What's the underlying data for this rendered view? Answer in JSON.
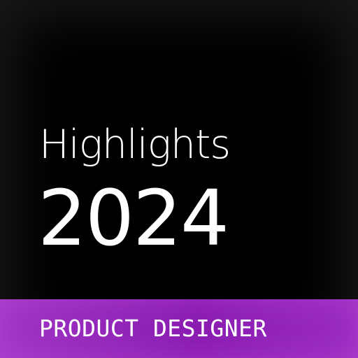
{
  "cover": {
    "title": "Highlights",
    "year": "2024",
    "role": "PRODUCT DESIGNER"
  },
  "colors": {
    "background": "#000000",
    "text": "#ffffff",
    "banner_accent": "#8a1cb2"
  }
}
